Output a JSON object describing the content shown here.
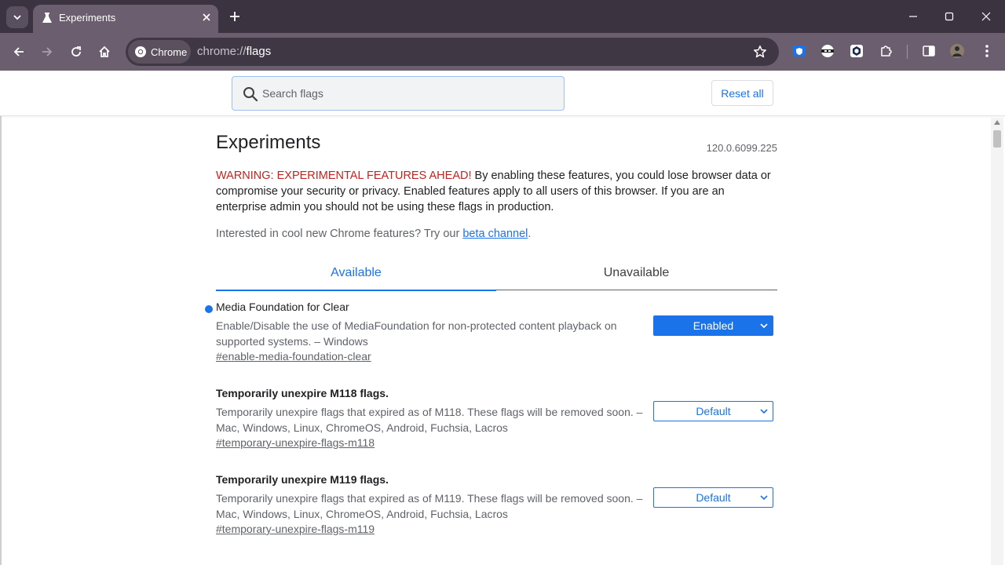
{
  "window": {
    "tab_title": "Experiments",
    "icons": {
      "tab_search": "chevron-down-icon",
      "favicon": "flask-icon",
      "tab_close": "close-icon",
      "new_tab": "plus-icon",
      "minimize": "minimize-icon",
      "maximize": "maximize-icon",
      "close": "close-icon"
    }
  },
  "toolbar": {
    "chip_label": "Chrome",
    "url_scheme": "chrome://",
    "url_path": "flags",
    "icons": [
      "back-icon",
      "forward-icon",
      "reload-icon",
      "home-icon",
      "star-icon",
      "shield-extension-icon",
      "ninja-extension-icon",
      "cube-extension-icon",
      "puzzle-icon",
      "side-panel-icon",
      "avatar",
      "kebab-menu-icon"
    ]
  },
  "header": {
    "search_placeholder": "Search flags",
    "reset_label": "Reset all"
  },
  "main": {
    "title": "Experiments",
    "version": "120.0.6099.225",
    "warning_red": "WARNING: EXPERIMENTAL FEATURES AHEAD!",
    "warning_text": " By enabling these features, you could lose browser data or compromise your security or privacy. Enabled features apply to all users of this browser. If you are an enterprise admin you should not be using these flags in production.",
    "interest_text": "Interested in cool new Chrome features? Try our ",
    "interest_link": "beta channel",
    "interest_end": ".",
    "tabs": [
      {
        "label": "Available",
        "active": true
      },
      {
        "label": "Unavailable",
        "active": false
      }
    ],
    "flags": [
      {
        "name": "Media Foundation for Clear",
        "description": "Enable/Disable the use of MediaFoundation for non-protected content playback on supported systems. – Windows",
        "link": "#enable-media-foundation-clear",
        "value": "Enabled"
      },
      {
        "name": "Temporarily unexpire M118 flags.",
        "description": "Temporarily unexpire flags that expired as of M118. These flags will be removed soon. – Mac, Windows, Linux, ChromeOS, Android, Fuchsia, Lacros",
        "link": "#temporary-unexpire-flags-m118",
        "value": "Default"
      },
      {
        "name": "Temporarily unexpire M119 flags.",
        "description": "Temporarily unexpire flags that expired as of M119. These flags will be removed soon. – Mac, Windows, Linux, ChromeOS, Android, Fuchsia, Lacros",
        "link": "#temporary-unexpire-flags-m119",
        "value": "Default"
      }
    ]
  },
  "colors": {
    "accent": "#1a73e8",
    "warning": "#c5221f",
    "frame": "#3c3340",
    "toolbar": "#6b5f6f"
  }
}
